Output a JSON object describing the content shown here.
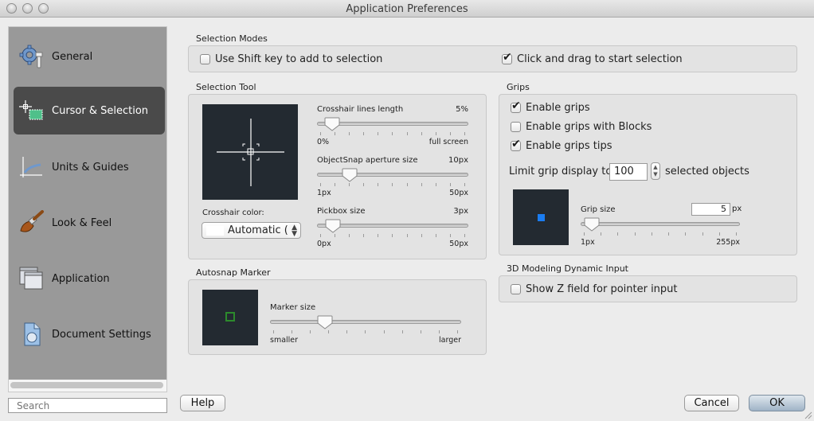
{
  "window": {
    "title": "Application Preferences"
  },
  "sidebar": {
    "items": [
      {
        "label": "General",
        "icon": "gear-wrench-icon",
        "selected": false
      },
      {
        "label": "Cursor & Selection",
        "icon": "crosshair-selection-icon",
        "selected": true
      },
      {
        "label": "Units & Guides",
        "icon": "ruler-axes-icon",
        "selected": false
      },
      {
        "label": "Look & Feel",
        "icon": "paintbrush-icon",
        "selected": false
      },
      {
        "label": "Application",
        "icon": "windows-icon",
        "selected": false
      },
      {
        "label": "Document Settings",
        "icon": "document-icon",
        "selected": false
      }
    ],
    "search_placeholder": "Search"
  },
  "selection_modes": {
    "heading": "Selection Modes",
    "shift_key": {
      "label": "Use Shift key to add to selection",
      "checked": false
    },
    "click_drag": {
      "label": "Click and drag to start selection",
      "checked": true
    }
  },
  "selection_tool": {
    "heading": "Selection Tool",
    "crosshair_color_label": "Crosshair color:",
    "crosshair_color_value": "Automatic (",
    "sliders": [
      {
        "label": "Crosshair lines length",
        "value": "5%",
        "min": "0%",
        "max": "full screen",
        "fraction": 0.05
      },
      {
        "label": "ObjectSnap aperture size",
        "value": "10px",
        "min": "1px",
        "max": "50px",
        "fraction": 0.18
      },
      {
        "label": "Pickbox size",
        "value": "3px",
        "min": "0px",
        "max": "50px",
        "fraction": 0.06
      }
    ]
  },
  "autosnap": {
    "heading": "Autosnap Marker",
    "slider": {
      "label": "Marker size",
      "min": "smaller",
      "max": "larger",
      "fraction": 0.27
    },
    "marker_color": "#2c8a2c"
  },
  "grips": {
    "heading": "Grips",
    "enable_grips": {
      "label": "Enable grips",
      "checked": true
    },
    "enable_blocks": {
      "label": "Enable grips with Blocks",
      "checked": false
    },
    "enable_tips": {
      "label": "Enable grips tips",
      "checked": true
    },
    "limit_label": "Limit grip display to",
    "limit_value": "100",
    "limit_suffix": "selected objects",
    "grip_size": {
      "label": "Grip size",
      "value": "5",
      "unit": "px",
      "min": "1px",
      "max": "255px",
      "fraction": 0.02
    },
    "grip_color": "#1a7cf0"
  },
  "dynamic_input": {
    "heading": "3D Modeling Dynamic Input",
    "show_z": {
      "label": "Show Z field for pointer input",
      "checked": false
    }
  },
  "buttons": {
    "help": "Help",
    "cancel": "Cancel",
    "ok": "OK"
  }
}
